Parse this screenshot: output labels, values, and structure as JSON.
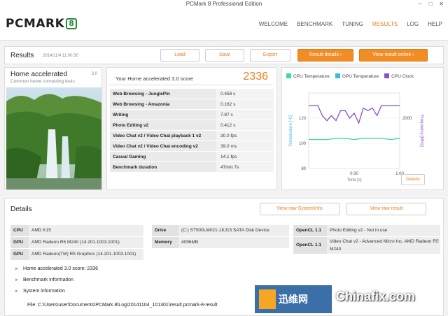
{
  "window": {
    "title": "PCMark 8 Professional Edition",
    "controls": [
      "‒",
      "□",
      "✕"
    ]
  },
  "logo": {
    "text": "PCMARK",
    "badge": "8"
  },
  "nav": {
    "items": [
      "WELCOME",
      "BENCHMARK",
      "TUNING",
      "RESULTS",
      "LOG",
      "HELP"
    ],
    "active": "RESULTS"
  },
  "results": {
    "title": "Results",
    "date": "2014/11/4 11:00:30",
    "buttons": {
      "load": "Load",
      "save": "Save",
      "export": "Export",
      "result_details": "Result details ›",
      "view_online": "View result online ›"
    }
  },
  "hero": {
    "title": "Home accelerated",
    "version": "3.0",
    "subtitle": "Common home computing tests"
  },
  "score": {
    "label": "Your Home accelerated 3.0 score",
    "value": "2336",
    "rows": [
      {
        "name": "Web Browsing - JunglePin",
        "value": "0.458 s"
      },
      {
        "name": "Web Browsing - Amazonia",
        "value": "0.162 s"
      },
      {
        "name": "Writing",
        "value": "7.87 s"
      },
      {
        "name": "Photo Editing v2",
        "value": "0.412 s"
      },
      {
        "name": "Video Chat v2 / Video Chat playback 1 v2",
        "value": "30.0 fps"
      },
      {
        "name": "Video Chat v2 / Video Chat encoding v2",
        "value": "39.0 ms"
      },
      {
        "name": "Casual Gaming",
        "value": "14.1 fps"
      },
      {
        "name": "Benchmark duration",
        "value": "47min 7s"
      }
    ]
  },
  "chart": {
    "legend": [
      "CPU Temperature",
      "GPU Temperature",
      "CPU Clock"
    ],
    "y_left_label": "Temperature [°C]",
    "y_right_label": "Frequency [MHz]",
    "x_label": "Time [s]",
    "details_label": "Details"
  },
  "chart_data": {
    "type": "line",
    "xlabel": "Time [s]",
    "ylabel": "Temperature [°C]",
    "y2label": "Frequency [MHz]",
    "xlim": [
      0,
      1.0
    ],
    "ylim": [
      80,
      140
    ],
    "y2lim": [
      0,
      3000
    ],
    "x_ticks": [
      "0:30",
      "1:00"
    ],
    "y_ticks": [
      80,
      100,
      120
    ],
    "y2_ticks": [
      2000
    ],
    "series": [
      {
        "name": "CPU Temperature",
        "color": "#3dd6b0",
        "axis": "left",
        "x": [
          0,
          0.1,
          0.2,
          0.3,
          0.4,
          0.5,
          0.6,
          0.7,
          0.8,
          0.9,
          1.0
        ],
        "values": [
          103,
          103,
          103,
          104,
          104,
          103,
          104,
          104,
          104,
          103,
          104
        ]
      },
      {
        "name": "CPU Clock",
        "color": "#8b4fc6",
        "axis": "right",
        "x": [
          0,
          0.1,
          0.15,
          0.2,
          0.25,
          0.3,
          0.35,
          0.4,
          0.45,
          0.5,
          0.55,
          0.6,
          0.65,
          0.7,
          0.75,
          0.8,
          0.85,
          0.9,
          0.95,
          1.0
        ],
        "values": [
          2500,
          2500,
          2100,
          1900,
          2100,
          1900,
          2300,
          2300,
          2000,
          2200,
          1800,
          2400,
          2300,
          2400,
          2100,
          2500,
          2500,
          2500,
          2500,
          2500
        ]
      }
    ]
  },
  "details": {
    "title": "Details",
    "view_sysinfo": "View raw SystemInfo",
    "view_result": "View raw result",
    "cpu": {
      "label": "CPU",
      "value": "AMD K15"
    },
    "gpu1": {
      "label": "GPU",
      "value": "AMD Radeon R5 M240 (14.201.1003.1001)"
    },
    "gpu2": {
      "label": "GPU",
      "value": "AMD Radeon(TM) R5 Graphics (14.201.1003.1001)"
    },
    "drive": {
      "label": "Drive",
      "value": "(C:) ST500LM021-1KJ15 SATA Disk Device"
    },
    "memory": {
      "label": "Memory",
      "value": "4096MB"
    },
    "opencl1": {
      "label": "OpenCL 1.1",
      "value": "Photo Editing v2 - Not in use"
    },
    "opencl2": {
      "label": "OpenCL 1.1",
      "value": "Video Chat v2 - Advanced Micro Inc. AMD Radeon R5 M240"
    },
    "sections": [
      "Home accelerated 3.0 score: 2336",
      "Benchmark information",
      "System information"
    ],
    "file": "File: C:\\Users\\user\\Documents\\PCMark 8\\Log\\20141104_101301\\result.pcmark-8-result"
  },
  "watermark": {
    "cn": "迅维网",
    "en": "Chinafix.com"
  }
}
